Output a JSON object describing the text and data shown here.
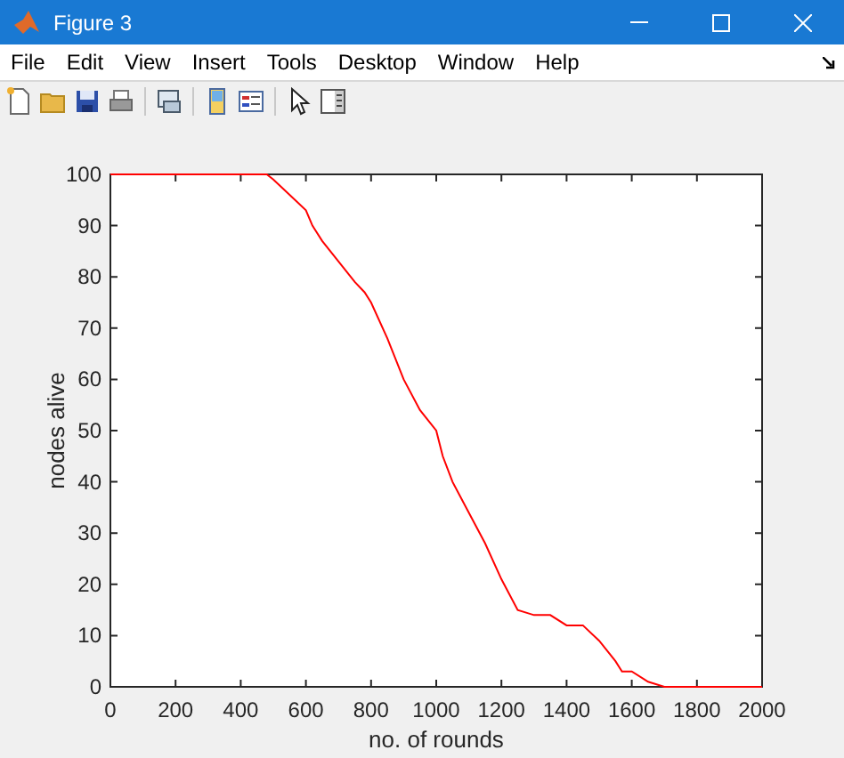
{
  "window": {
    "title": "Figure 3"
  },
  "menu": [
    "File",
    "Edit",
    "View",
    "Insert",
    "Tools",
    "Desktop",
    "Window",
    "Help"
  ],
  "toolbar": [
    {
      "kind": "new"
    },
    {
      "kind": "open"
    },
    {
      "kind": "save"
    },
    {
      "kind": "print"
    },
    {
      "kind": "sep"
    },
    {
      "kind": "link"
    },
    {
      "kind": "sep"
    },
    {
      "kind": "colorbar"
    },
    {
      "kind": "legend"
    },
    {
      "kind": "sep"
    },
    {
      "kind": "pointer"
    },
    {
      "kind": "panel"
    }
  ],
  "plot": {
    "chart_data": {
      "type": "line",
      "xlabel": "no. of rounds",
      "ylabel": "nodes alive",
      "xlim": [
        0,
        2000
      ],
      "ylim": [
        0,
        100
      ],
      "xticks": [
        0,
        200,
        400,
        600,
        800,
        1000,
        1200,
        1400,
        1600,
        1800,
        2000
      ],
      "yticks": [
        0,
        10,
        20,
        30,
        40,
        50,
        60,
        70,
        80,
        90,
        100
      ],
      "x": [
        0,
        100,
        200,
        300,
        400,
        450,
        480,
        500,
        550,
        600,
        620,
        650,
        700,
        750,
        780,
        800,
        850,
        900,
        950,
        1000,
        1020,
        1050,
        1100,
        1150,
        1200,
        1250,
        1300,
        1350,
        1400,
        1450,
        1500,
        1550,
        1570,
        1600,
        1650,
        1700,
        1750,
        1800,
        1900,
        2000
      ],
      "series": [
        {
          "color": "#ff0000",
          "values": [
            100,
            100,
            100,
            100,
            100,
            100,
            100,
            99,
            96,
            93,
            90,
            87,
            83,
            79,
            77,
            75,
            68,
            60,
            54,
            50,
            45,
            40,
            34,
            28,
            21,
            15,
            14,
            14,
            12,
            12,
            9,
            5,
            3,
            3,
            1,
            0,
            0,
            0,
            0,
            0
          ]
        }
      ]
    }
  }
}
